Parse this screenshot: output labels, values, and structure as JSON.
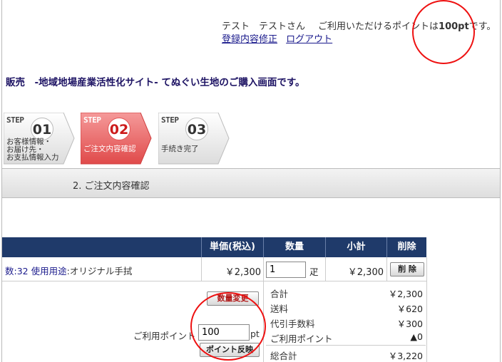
{
  "header": {
    "user_name": "テスト　テストさん",
    "points_prefix": "ご利用いただけるポイントは",
    "points_value": "100pt",
    "points_suffix": "です。",
    "edit_link": "登録内容修正",
    "logout_link": "ログアウト"
  },
  "headline": "販売　-地域地場産業活性化サイト- てぬぐい生地のご購入画面です。",
  "steps": [
    {
      "label": "STEP",
      "number": "01",
      "text": "お客様情報・\nお届け先・\nお支払情報入力"
    },
    {
      "label": "STEP",
      "number": "02",
      "text": "ご注文内容確認"
    },
    {
      "label": "STEP",
      "number": "03",
      "text": "手続き完了"
    }
  ],
  "section_title": "2. ご注文内容確認",
  "table": {
    "headers": {
      "unit_price": "単価(税込)",
      "quantity": "数量",
      "subtotal": "小計",
      "delete": "削除"
    },
    "row": {
      "prefix": "数:32 ",
      "usage_label": "使用用途",
      "usage_value": ":オリジナル手拭",
      "unit_price": "￥2,300",
      "quantity": "1",
      "unit": "疋",
      "subtotal": "￥2,300",
      "delete_button": "削 除"
    }
  },
  "buttons": {
    "quantity_change": "数量変更",
    "point_reflect": "ポイント反映"
  },
  "points": {
    "label": "ご利用ポイント",
    "value": "100",
    "unit": "pt"
  },
  "summary": [
    {
      "label": "合計",
      "value": "￥2,300"
    },
    {
      "label": "送料",
      "value": "￥620"
    },
    {
      "label": "代引手数料",
      "value": "￥300"
    },
    {
      "label": "ご利用ポイント",
      "value": "▲0"
    },
    {
      "label": "総合計",
      "value": "￥3,220"
    }
  ],
  "colors": {
    "table_header": "#1f3a6a",
    "step_active": "#e85c5c",
    "annotation": "#ee1111",
    "headline": "#1e1464"
  }
}
